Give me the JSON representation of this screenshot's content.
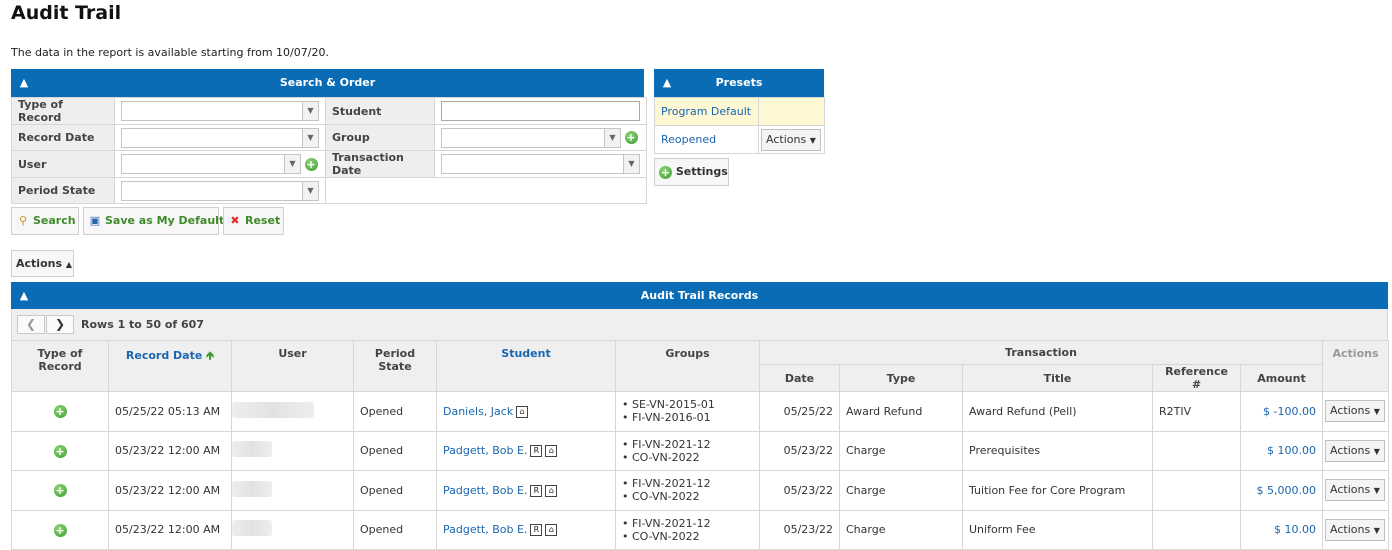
{
  "page": {
    "title": "Audit Trail",
    "note": "The data in the report is available starting from 10/07/20."
  },
  "search_panel": {
    "title": "Search & Order",
    "fields": {
      "type_of_record": "Type of Record",
      "record_date": "Record Date",
      "user": "User",
      "period_state": "Period State",
      "student": "Student",
      "group": "Group",
      "transaction_date": "Transaction Date"
    },
    "buttons": {
      "search": "Search",
      "save_default": "Save as My Default",
      "reset": "Reset"
    }
  },
  "presets_panel": {
    "title": "Presets",
    "items": [
      "Program Default",
      "Reopened"
    ],
    "actions_label": "Actions",
    "settings_label": "Settings"
  },
  "toolbar": {
    "actions_label": "Actions"
  },
  "records": {
    "title": "Audit Trail Records",
    "rows_info": "Rows 1 to 50 of 607",
    "headers": {
      "type": "Type of Record",
      "record_date": "Record Date",
      "user": "User",
      "period_state": "Period State",
      "student": "Student",
      "groups": "Groups",
      "transaction": "Transaction",
      "date": "Date",
      "ttype": "Type",
      "title": "Title",
      "reference": "Reference #",
      "amount": "Amount",
      "actions": "Actions"
    },
    "rows": [
      {
        "record_date": "05/25/22 05:13 AM",
        "period_state": "Opened",
        "student": "Daniels, Jack",
        "groups": [
          "• SE-VN-2015-01",
          "• FI-VN-2016-01"
        ],
        "date": "05/25/22",
        "type": "Award Refund",
        "title": "Award Refund (Pell)",
        "reference": "R2TIV",
        "amount": "$ -100.00",
        "actions": "Actions"
      },
      {
        "record_date": "05/23/22 12:00 AM",
        "period_state": "Opened",
        "student": "Padgett, Bob E.",
        "groups": [
          "• FI-VN-2021-12",
          "• CO-VN-2022"
        ],
        "date": "05/23/22",
        "type": "Charge",
        "title": "Prerequisites",
        "reference": "",
        "amount": "$ 100.00",
        "actions": "Actions"
      },
      {
        "record_date": "05/23/22 12:00 AM",
        "period_state": "Opened",
        "student": "Padgett, Bob E.",
        "groups": [
          "• FI-VN-2021-12",
          "• CO-VN-2022"
        ],
        "date": "05/23/22",
        "type": "Charge",
        "title": "Tuition Fee for Core Program",
        "reference": "",
        "amount": "$ 5,000.00",
        "actions": "Actions"
      },
      {
        "record_date": "05/23/22 12:00 AM",
        "period_state": "Opened",
        "student": "Padgett, Bob E.",
        "groups": [
          "• FI-VN-2021-12",
          "• CO-VN-2022"
        ],
        "date": "05/23/22",
        "type": "Charge",
        "title": "Uniform Fee",
        "reference": "",
        "amount": "$ 10.00",
        "actions": "Actions"
      }
    ]
  },
  "colors": {
    "header_blue": "#0a6cb5",
    "link_blue": "#1a66b0",
    "button_green": "#3f8a2a"
  }
}
